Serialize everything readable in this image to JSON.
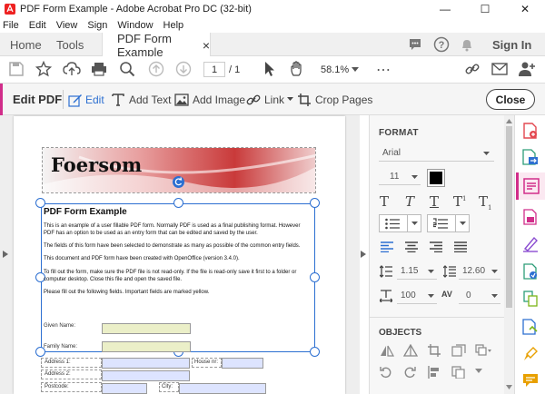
{
  "window": {
    "title": "PDF Form Example - Adobe Acrobat Pro DC (32-bit)"
  },
  "menu": [
    "File",
    "Edit",
    "View",
    "Sign",
    "Window",
    "Help"
  ],
  "tabs": {
    "home": "Home",
    "tools": "Tools",
    "doc": "PDF Form Example",
    "close": "×",
    "signin": "Sign In"
  },
  "toolbar": {
    "page_current": "1",
    "page_total": "/ 1",
    "zoom": "58.1%"
  },
  "editbar": {
    "title": "Edit PDF",
    "edit": "Edit",
    "add_text": "Add Text",
    "add_image": "Add Image",
    "link": "Link",
    "crop": "Crop Pages",
    "close": "Close"
  },
  "format": {
    "heading": "FORMAT",
    "font": "Arial",
    "size": "11",
    "line_spacing": "1.15",
    "para_spacing": "12.60",
    "scale": "100",
    "char_spacing": "0",
    "objects_heading": "OBJECTS",
    "text_color": "#000000"
  },
  "doc": {
    "logo": "Foersom",
    "heading": "PDF Form Example",
    "p1": "This is an example of a user fillable PDF form. Normally PDF is used as a final publishing format. However PDF has an option to be used as an entry form that can be edited and saved by the user.",
    "p2": "The fields of this form have been selected to demonstrate as many as possible of the common entry fields.",
    "p3": "This document and PDF form have been created with OpenOffice (version 3.4.0).",
    "p4": "To fill out the form, make sure the PDF file is not read-only. If the file is read-only save it first to a folder or computer desktop. Close this file and open the saved file.",
    "p5": "Please fill out the following fields. Important fields are marked yellow.",
    "given_name": "Given Name:",
    "family_name": "Family Name:",
    "address1": "Address 1:",
    "house_nr": "House nr:",
    "address2": "Address 2:",
    "postcode": "Postcode:",
    "city": "City:"
  },
  "colors": {
    "accent_pink": "#d12d8a",
    "field_yellow": "#ebefc8",
    "field_blue": "#dde4ff",
    "handle_blue": "#2c6fd1"
  }
}
